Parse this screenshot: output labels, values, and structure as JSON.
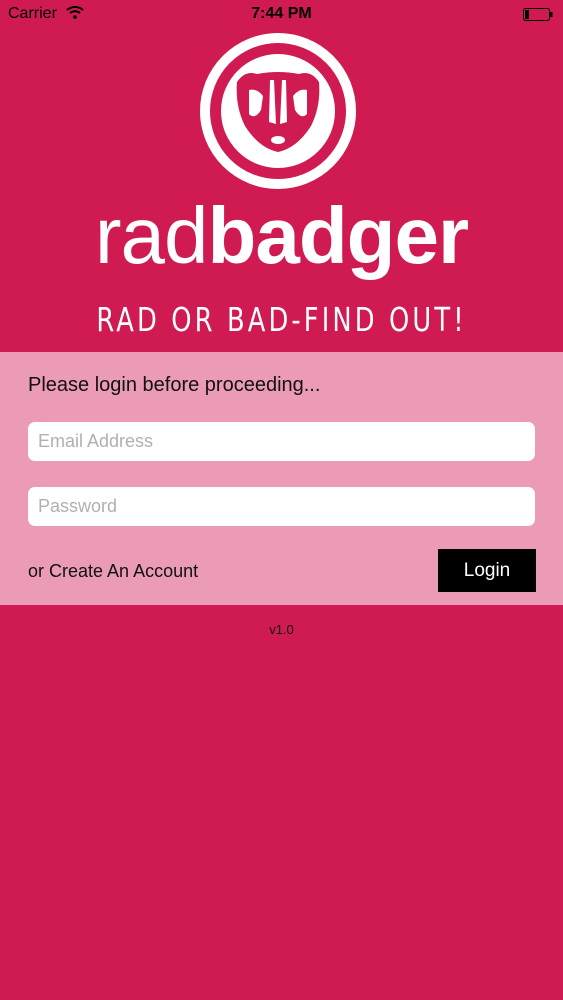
{
  "status_bar": {
    "carrier": "Carrier",
    "time": "7:44 PM",
    "wifi_icon": "wifi-icon",
    "battery_icon": "battery-icon"
  },
  "brand": {
    "name_light": "rad",
    "name_bold": "badger",
    "tagline": "RAD OR BAD-FIND OUT!",
    "logo_icon": "badger-logo-icon"
  },
  "login": {
    "prompt": "Please login before proceeding...",
    "email_placeholder": "Email Address",
    "password_placeholder": "Password",
    "create_account_link": "or Create An Account",
    "login_button": "Login"
  },
  "footer": {
    "version": "v1.0"
  },
  "colors": {
    "background": "#cf1b52",
    "panel": "#eb9bb6",
    "button": "#000000"
  }
}
